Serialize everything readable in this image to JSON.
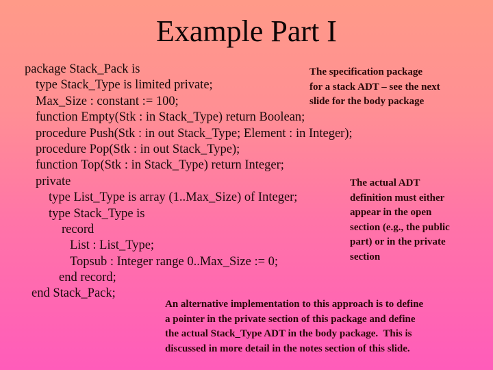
{
  "slide": {
    "title": "Example Part I",
    "background_colors": [
      "#ff9a88",
      "#ff5cba"
    ],
    "code_lines": [
      {
        "indent": 36,
        "text": "package Stack_Pack is"
      },
      {
        "indent": 52,
        "text": "type Stack_Type is limited private;"
      },
      {
        "indent": 52,
        "text": "Max_Size : constant := 100;"
      },
      {
        "indent": 52,
        "text": "function Empty(Stk : in Stack_Type) return Boolean;"
      },
      {
        "indent": 52,
        "text": "procedure Push(Stk : in out Stack_Type; Element : in Integer);"
      },
      {
        "indent": 52,
        "text": "procedure Pop(Stk : in out Stack_Type);"
      },
      {
        "indent": 52,
        "text": "function Top(Stk : in Stack_Type) return Integer;"
      },
      {
        "indent": 52,
        "text": "private"
      },
      {
        "indent": 71,
        "text": "type List_Type is array (1..Max_Size) of Integer;"
      },
      {
        "indent": 71,
        "text": "type Stack_Type is"
      },
      {
        "indent": 90,
        "text": "record"
      },
      {
        "indent": 102,
        "text": "List : List_Type;"
      },
      {
        "indent": 102,
        "text": "Topsub : Integer range 0..Max_Size := 0;"
      },
      {
        "indent": 86,
        "text": "end record;"
      },
      {
        "indent": 46,
        "text": "end Stack_Pack;"
      }
    ],
    "notes": {
      "spec": [
        "The specification package",
        "for a stack ADT – see the next",
        "slide for the body package"
      ],
      "adt": [
        "The actual ADT",
        "definition must either",
        "appear in the open",
        "section (e.g., the public",
        "part) or in the private",
        "section"
      ],
      "alt": [
        "An alternative implementation to this approach is to define",
        "a pointer in the private section of this package and define",
        "the actual Stack_Type ADT in the body package.  This is",
        "discussed in more detail in the notes section of this slide."
      ]
    }
  }
}
